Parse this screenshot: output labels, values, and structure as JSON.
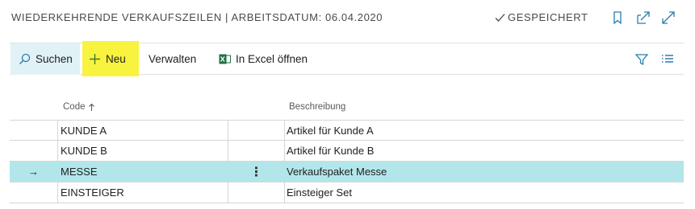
{
  "header": {
    "title": "WIEDERKEHRENDE VERKAUFSZEILEN | ARBEITSDATUM: 06.04.2020",
    "saved_status": "GESPEICHERT",
    "icons": [
      "bookmark-icon",
      "popout-icon",
      "expand-icon"
    ]
  },
  "actions": {
    "search_label": "Suchen",
    "new_label": "Neu",
    "manage_label": "Verwalten",
    "excel_label": "In Excel öffnen"
  },
  "table": {
    "columns": {
      "code": "Code",
      "description": "Beschreibung"
    },
    "sort": "ascending",
    "rows": [
      {
        "code": "KUNDE A",
        "description": "Artikel für Kunde A",
        "selected": false
      },
      {
        "code": "KUNDE B",
        "description": "Artikel für Kunde B",
        "selected": false
      },
      {
        "code": "MESSE",
        "description": "Verkaufspaket Messe",
        "selected": true,
        "arrow": "→",
        "menu": "⋮"
      },
      {
        "code": "EINSTEIGER",
        "description": "Einsteiger Set",
        "selected": false
      }
    ]
  },
  "colors": {
    "highlight": "#f7f33f",
    "selected_row": "#b2e6ea",
    "search_bg": "#e1f2f7",
    "accent": "#2a7da8",
    "excel": "#1e7145"
  }
}
